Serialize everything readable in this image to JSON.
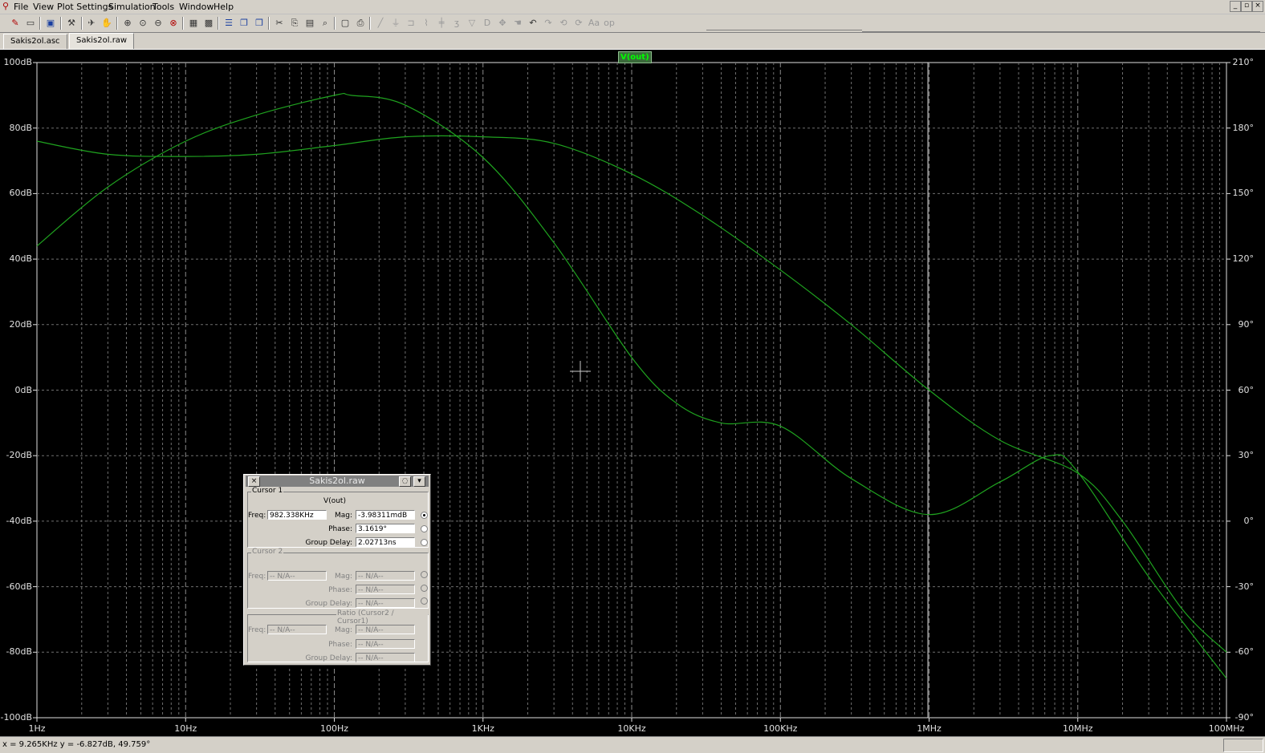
{
  "menu": {
    "items": [
      "File",
      "View",
      "Plot Settings",
      "Simulation",
      "Tools",
      "Window",
      "Help"
    ]
  },
  "tabs": [
    {
      "label": "Sakis2ol.asc",
      "active": false
    },
    {
      "label": "Sakis2ol.raw",
      "active": true
    }
  ],
  "plot": {
    "trace_label": "V(out)",
    "left_axis_labels": [
      "100dB",
      "80dB",
      "60dB",
      "40dB",
      "20dB",
      "0dB",
      "-20dB",
      "-40dB",
      "-60dB",
      "-80dB",
      "-100dB"
    ],
    "right_axis_labels": [
      "210°",
      "180°",
      "150°",
      "120°",
      "90°",
      "60°",
      "30°",
      "0°",
      "-30°",
      "-60°",
      "-90°"
    ],
    "x_axis_labels": [
      "1Hz",
      "10Hz",
      "100Hz",
      "1KHz",
      "10KHz",
      "100KHz",
      "1MHz",
      "10MHz",
      "100MHz"
    ],
    "trace_color": "#1fa31f",
    "grid_color": "#6f6f6f",
    "background": "#000000"
  },
  "chart_data": {
    "type": "line",
    "title": "",
    "xlabel": "",
    "ylabel": "",
    "x_scale": "log",
    "xlim": [
      1,
      100000000
    ],
    "ylim": [
      -100,
      100
    ],
    "y2lim": [
      -90,
      210
    ],
    "grid": true,
    "legend": "top-center",
    "series": [
      {
        "name": "V(out)",
        "quantity": "magnitude (dB)",
        "axis": "left",
        "x": [
          1,
          3,
          10,
          30,
          100,
          130,
          300,
          1000,
          3000,
          10000,
          20000,
          40000,
          100000,
          300000,
          1000000,
          3000000,
          6500000,
          10000000,
          30000000,
          100000000
        ],
        "y": [
          44,
          62,
          76,
          84,
          90,
          90,
          87,
          71,
          45,
          10,
          -4,
          -10,
          -11,
          -27,
          -38,
          -28,
          -20,
          -25,
          -57,
          -88
        ]
      },
      {
        "name": "",
        "quantity": "phase (degrees)",
        "axis": "right",
        "x": [
          1,
          3,
          10,
          30,
          100,
          300,
          1000,
          3000,
          10000,
          30000,
          100000,
          300000,
          1000000,
          3000000,
          10000000,
          20000000,
          50000000,
          100000000
        ],
        "y": [
          174,
          168,
          167,
          168,
          172,
          176,
          176,
          173,
          159,
          140,
          115,
          90,
          60,
          37,
          22,
          0,
          -40,
          -60
        ]
      }
    ]
  },
  "panel": {
    "title": "Sakis2ol.raw",
    "cursor1": {
      "group": "Cursor 1",
      "signal": "V(out)",
      "freq_label": "Freq:",
      "freq": "982.338KHz",
      "mag_label": "Mag:",
      "mag": "-3.98311mdB",
      "phase_label": "Phase:",
      "phase": "3.1619°",
      "gd_label": "Group Delay:",
      "gd": "2.02713ns"
    },
    "cursor2": {
      "group": "Cursor 2",
      "freq_label": "Freq:",
      "freq": "-- N/A--",
      "mag_label": "Mag:",
      "mag": "-- N/A--",
      "phase_label": "Phase:",
      "phase": "-- N/A--",
      "gd_label": "Group Delay:",
      "gd": "-- N/A--"
    },
    "ratio": {
      "group": "Ratio (Cursor2 / Cursor1)",
      "freq_label": "Freq:",
      "freq": "-- N/A--",
      "mag_label": "Mag:",
      "mag": "-- N/A--",
      "phase_label": "Phase:",
      "phase": "-- N/A--",
      "gd_label": "Group Delay:",
      "gd": "-- N/A--"
    }
  },
  "status": {
    "coords": "x = 9.265KHz    y = -6.827dB, 49.759°"
  }
}
